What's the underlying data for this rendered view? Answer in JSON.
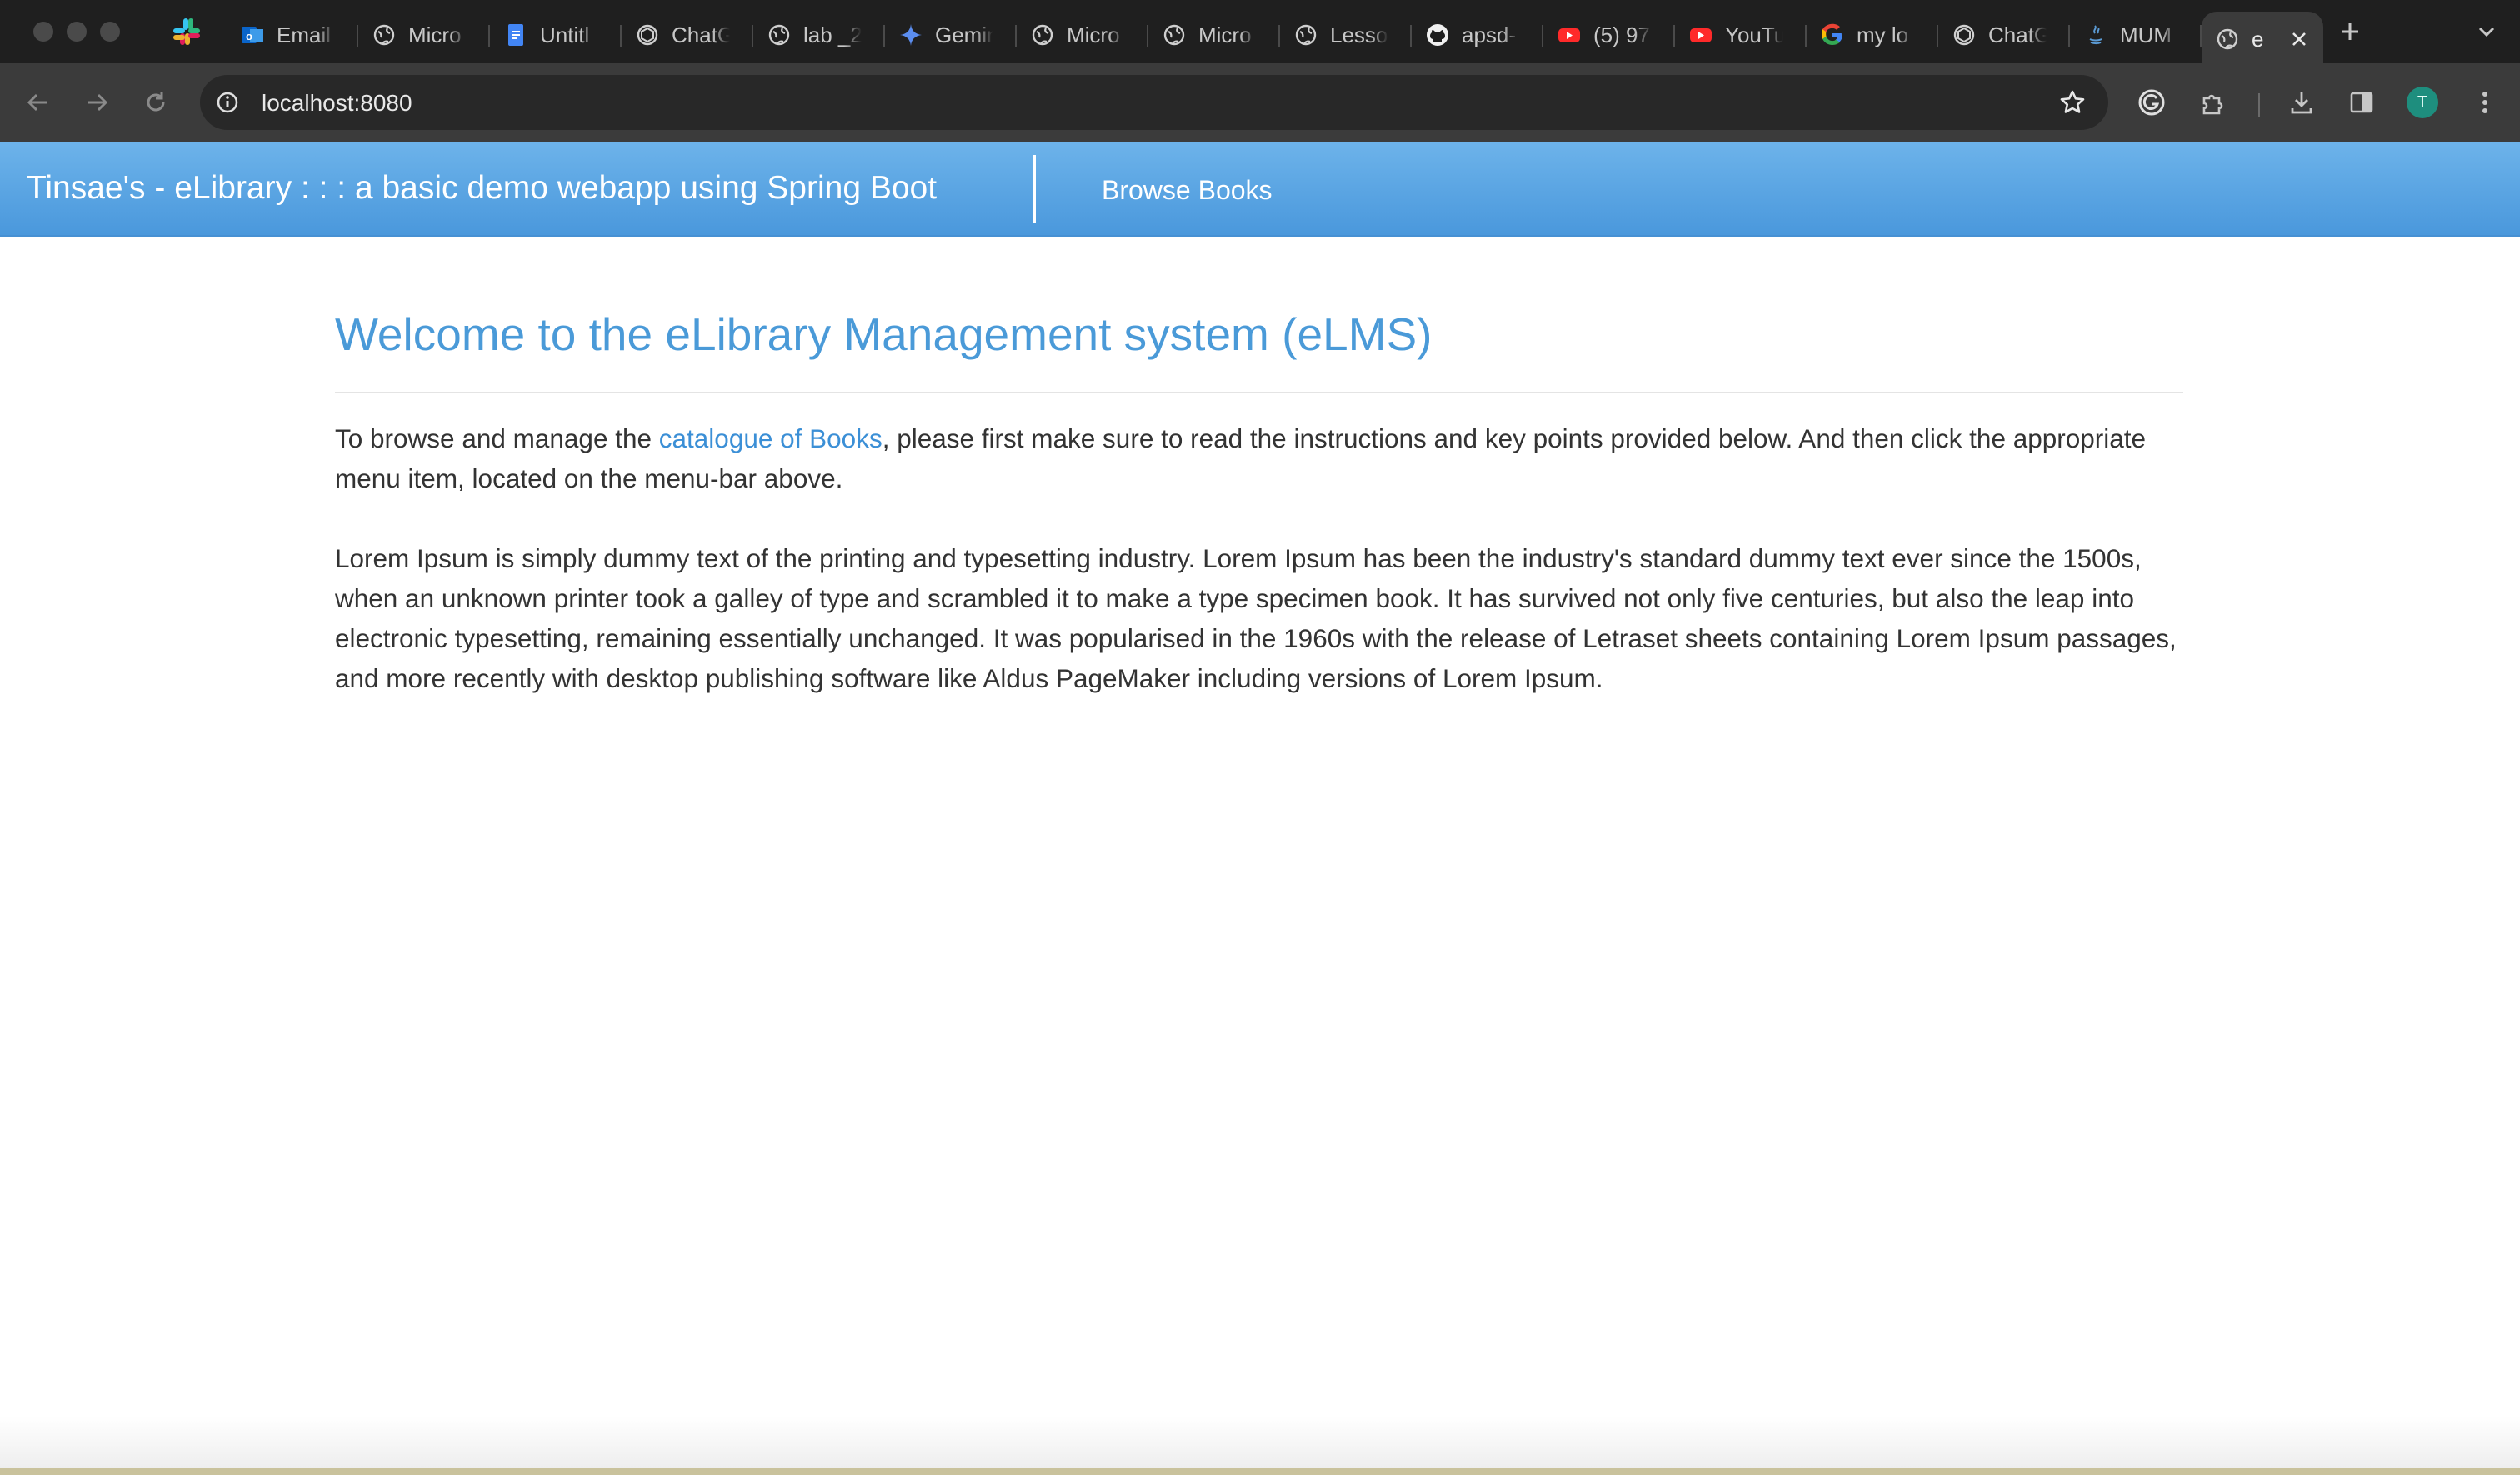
{
  "browser": {
    "tabs": [
      {
        "icon": "outlook-icon",
        "label": "Email"
      },
      {
        "icon": "globe-icon",
        "label": "Micro"
      },
      {
        "icon": "google-docs-icon",
        "label": "Untitl"
      },
      {
        "icon": "chatgpt-icon",
        "label": "ChatG"
      },
      {
        "icon": "globe-icon",
        "label": "lab _2"
      },
      {
        "icon": "gemini-icon",
        "label": "Gemin"
      },
      {
        "icon": "globe-icon",
        "label": "Micro"
      },
      {
        "icon": "globe-icon",
        "label": "Micro"
      },
      {
        "icon": "globe-icon",
        "label": "Lesso"
      },
      {
        "icon": "github-icon",
        "label": "apsd-"
      },
      {
        "icon": "youtube-icon",
        "label": "(5) 97"
      },
      {
        "icon": "youtube-icon",
        "label": "YouTu"
      },
      {
        "icon": "google-icon",
        "label": "my lo"
      },
      {
        "icon": "chatgpt-icon",
        "label": "ChatG"
      },
      {
        "icon": "java-icon",
        "label": "MUM"
      }
    ],
    "active_tab": {
      "icon": "globe-icon",
      "label": "e"
    },
    "url": "localhost:8080",
    "avatar_initial": "T",
    "colors": {
      "chrome_dark": "#1f1f1f",
      "toolbar": "#3b3b3b",
      "omnibox": "#282828"
    }
  },
  "navbar": {
    "brand": "Tinsae's - eLibrary : : : a basic demo webapp using Spring Boot",
    "links": [
      "Browse Books"
    ],
    "colors": {
      "top": "#6db3ea",
      "bottom": "#4a98dc"
    }
  },
  "main": {
    "heading": "Welcome to the eLibrary Management system (eLMS)",
    "intro_before_link": "To browse and manage the ",
    "intro_link": "catalogue of Books",
    "intro_after_link": ", please first make sure to read the instructions and key points provided below. And then click the appropriate menu item, located on the menu-bar above.",
    "lorem": "Lorem Ipsum is simply dummy text of the printing and typesetting industry. Lorem Ipsum has been the industry's standard dummy text ever since the 1500s, when an unknown printer took a galley of type and scrambled it to make a type specimen book. It has survived not only five centuries, but also the leap into electronic typesetting, remaining essentially unchanged. It was popularised in the 1960s with the release of Letraset sheets containing Lorem Ipsum passages, and more recently with desktop publishing software like Aldus PageMaker including versions of Lorem Ipsum.",
    "colors": {
      "heading": "#4a9ad8",
      "link": "#3b8fd6",
      "text": "#333333"
    }
  }
}
